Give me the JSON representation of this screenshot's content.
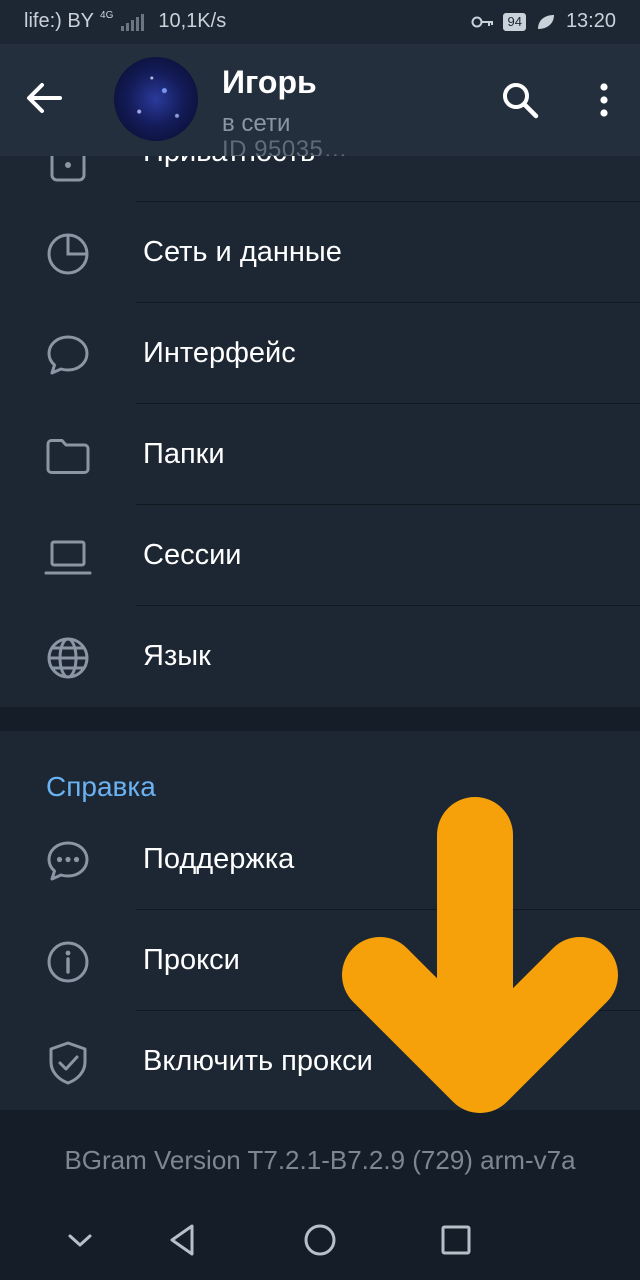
{
  "status_bar": {
    "carrier": "life:) BY",
    "network_type": "4G",
    "speed": "10,1K/s",
    "battery": "94",
    "time": "13:20"
  },
  "header": {
    "name": "Игорь",
    "status": "в сети",
    "id_text": "ID 95035…",
    "icons": {
      "back": "arrow-left-icon",
      "search": "search-icon",
      "more": "more-vertical-icon"
    }
  },
  "settings": {
    "partial_item": {
      "label": "Приватность",
      "icon": "lock-icon"
    },
    "items": [
      {
        "label": "Сеть и данные",
        "icon": "pie-chart-icon"
      },
      {
        "label": "Интерфейс",
        "icon": "chat-bubble-icon"
      },
      {
        "label": "Папки",
        "icon": "folder-icon"
      },
      {
        "label": "Сессии",
        "icon": "laptop-icon"
      },
      {
        "label": "Язык",
        "icon": "globe-icon"
      }
    ]
  },
  "help": {
    "title": "Справка",
    "items": [
      {
        "label": "Поддержка",
        "icon": "chat-dots-icon"
      },
      {
        "label": "Прокси",
        "icon": "info-icon"
      },
      {
        "label": "Включить прокси",
        "icon": "shield-check-icon"
      }
    ]
  },
  "footer": {
    "version": "BGram Version T7.2.1-B7.2.9 (729) arm-v7a"
  },
  "overlay": {
    "arrow_color": "#f7a10a"
  },
  "colors": {
    "background": "#1d2733",
    "header": "#242f3d",
    "accent": "#6ab2f2",
    "icon": "#8a96a3"
  }
}
